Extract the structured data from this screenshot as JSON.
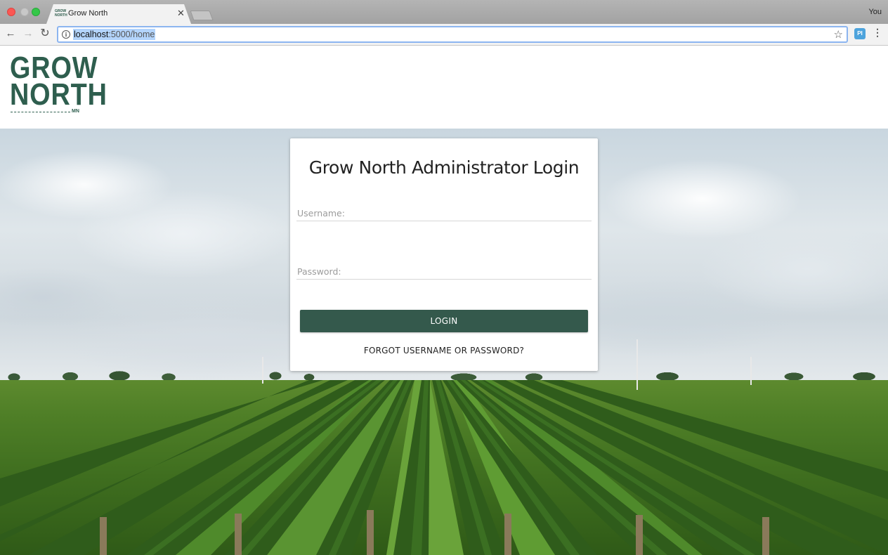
{
  "browser": {
    "tab_title": "Grow North",
    "tab_favicon_text": "GROW NORTH",
    "user_label": "You",
    "url_host": "localhost",
    "url_path": ":5000/home",
    "ext_icon_text": "PI"
  },
  "icons": {
    "back": "back-arrow-icon",
    "forward": "forward-arrow-icon",
    "reload": "reload-icon",
    "info": "info-icon",
    "star": "star-icon",
    "menu": "kebab-menu-icon",
    "close_tab": "close-icon"
  },
  "logo": {
    "line1": "GROW",
    "line2": "NORTH",
    "sub": "MN",
    "color": "#2e5e4e"
  },
  "login": {
    "title": "Grow North Administrator Login",
    "username_placeholder": "Username:",
    "password_placeholder": "Password:",
    "button_label": "LOGIN",
    "forgot_label": "FORGOT USERNAME OR PASSWORD?",
    "button_color": "#34594c"
  }
}
